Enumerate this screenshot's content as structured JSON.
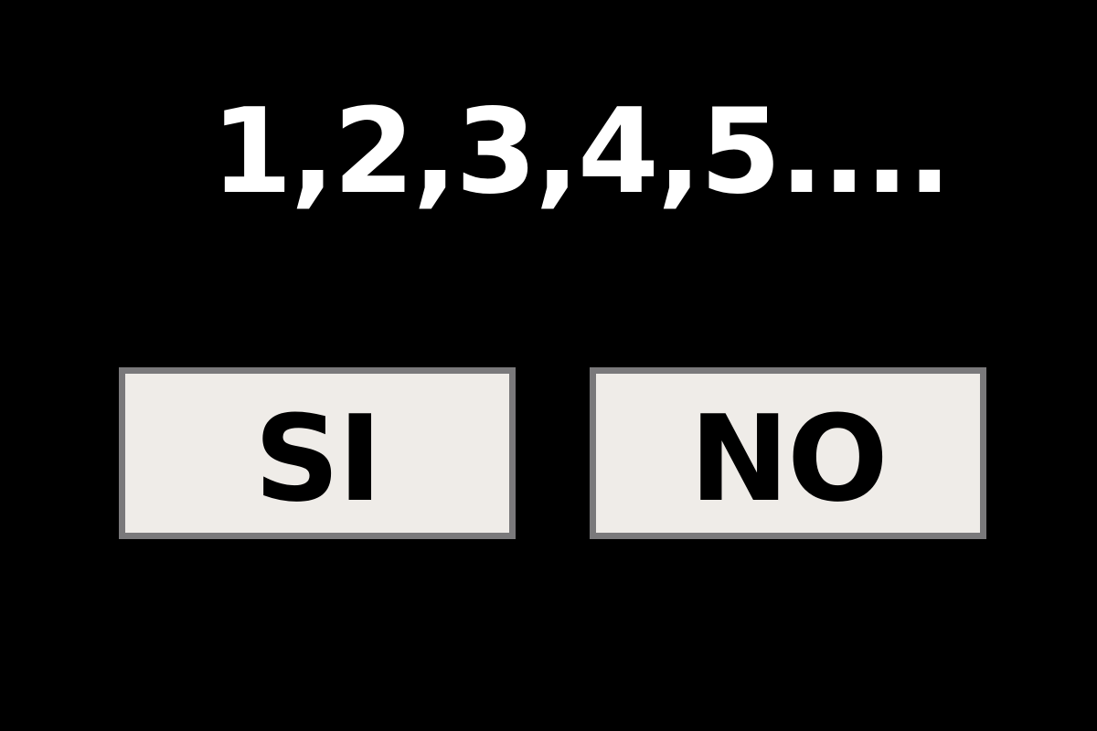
{
  "question": {
    "text": "1,2,3,4,5...."
  },
  "buttons": {
    "yes_label": "SI",
    "no_label": "NO"
  },
  "colors": {
    "background": "#000000",
    "text": "#ffffff",
    "button_fill": "#efece8",
    "button_border": "#7a797b"
  }
}
